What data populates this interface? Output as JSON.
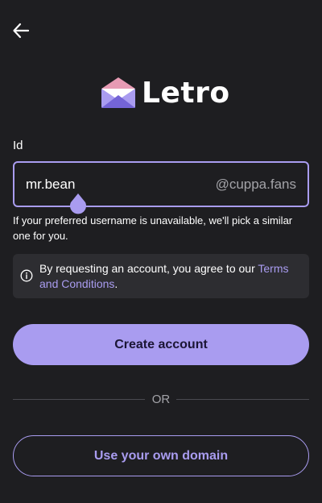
{
  "header": {
    "back_icon": "arrow-left-icon"
  },
  "brand": {
    "logo_icon": "envelope-logo-icon",
    "name": "Letro"
  },
  "id_field": {
    "label": "Id",
    "value": "mr.bean",
    "suffix": "@cuppa.fans",
    "helper": "If your preferred username is unavailable, we'll pick a similar one for you."
  },
  "notice": {
    "icon": "info-icon",
    "text_before": "By requesting an account, you agree to our ",
    "link": "Terms and Conditions",
    "text_after": "."
  },
  "actions": {
    "create_account": "Create account",
    "divider": "OR",
    "own_domain": "Use your own domain"
  },
  "colors": {
    "background": "#1e1e21",
    "accent": "#a99cf0",
    "surface": "#2d2d31",
    "muted_text": "#a3a3a8"
  }
}
